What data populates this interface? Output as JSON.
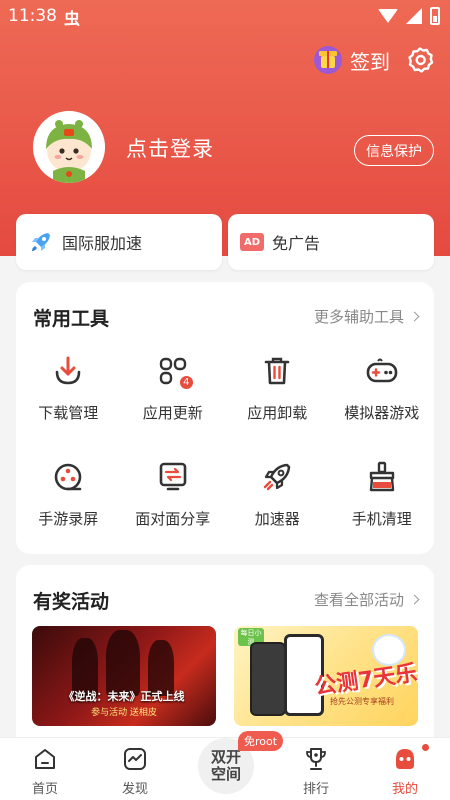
{
  "status_bar": {
    "time": "11:38",
    "app_icon": "虫"
  },
  "header": {
    "checkin_label": "签到",
    "login_text": "点击登录",
    "privacy_button": "信息保护"
  },
  "promos": [
    {
      "label": "国际服加速",
      "icon": "rocket-icon"
    },
    {
      "label": "免广告",
      "icon": "ad-icon",
      "icon_text": "AD"
    }
  ],
  "tools": {
    "title": "常用工具",
    "more": "更多辅助工具",
    "items": [
      {
        "label": "下载管理",
        "icon": "download-icon"
      },
      {
        "label": "应用更新",
        "icon": "app-update-icon",
        "badge": "4"
      },
      {
        "label": "应用卸载",
        "icon": "trash-icon"
      },
      {
        "label": "模拟器游戏",
        "icon": "gamepad-icon"
      },
      {
        "label": "手游录屏",
        "icon": "film-reel-icon"
      },
      {
        "label": "面对面分享",
        "icon": "share-transfer-icon"
      },
      {
        "label": "加速器",
        "icon": "rocket-icon"
      },
      {
        "label": "手机清理",
        "icon": "broom-icon"
      }
    ]
  },
  "events": {
    "title": "有奖活动",
    "more": "查看全部活动",
    "items": [
      {
        "caption": "《逆战：未来》正式上线",
        "sub": "参与活动 送相皮"
      },
      {
        "tag": "每日小测",
        "title": "公测7天乐",
        "sub": "抢先公测专享福利"
      }
    ]
  },
  "bottom_nav": {
    "items": [
      {
        "label": "首页",
        "icon": "home-icon"
      },
      {
        "label": "发现",
        "icon": "discover-icon"
      },
      {
        "label": "排行",
        "icon": "trophy-icon"
      },
      {
        "label": "我的",
        "icon": "mine-icon",
        "active": true
      }
    ],
    "center_label": "双开\n空间",
    "center_badge": "免root"
  },
  "colors": {
    "accent": "#e84c3d",
    "hero_top": "#ee6a55",
    "hero_bottom": "#e54a40"
  }
}
